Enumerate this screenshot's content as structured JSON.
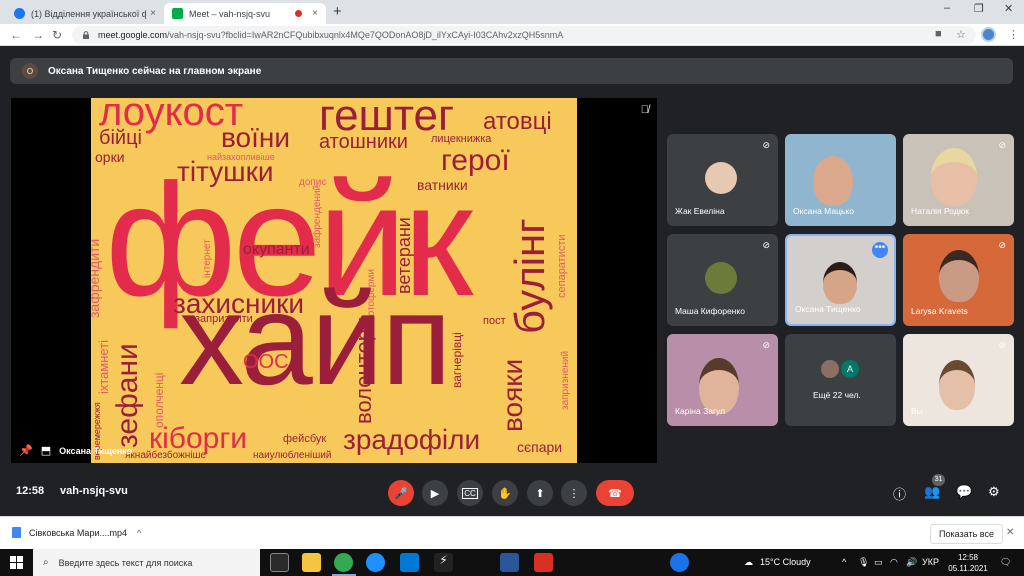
{
  "browser": {
    "tabs": [
      {
        "title": "(1) Відділення української філол",
        "close": "×"
      },
      {
        "title": "Meet – vah-nsjq-svu",
        "close": "×"
      }
    ],
    "new_tab": "+",
    "window_controls": [
      "–",
      "❐",
      "✕"
    ],
    "url_host": "meet.google.com",
    "url_path": "/vah-nsjq-svu?fbclid=IwAR2nCFQubibxuqnlx4MQe7QODonAO8jD_ilYxCAyi-I03CAhv2xzQH5snmA"
  },
  "banner": {
    "avatar_letter": "О",
    "text": "Оксана Тищенко сейчас на главном экране"
  },
  "stage": {
    "presenter_label": "Оксана Тищенко",
    "words": [
      "лоукост",
      "гештег",
      "атовці",
      "бійці",
      "воїни",
      "атошники",
      "лицекнижка",
      "орки",
      "найзахопливіше",
      "тітушки",
      "герої",
      "фейк",
      "допис",
      "ватники",
      "зафрендити",
      "інтернет",
      "зафрендений",
      "ветерани",
      "булінг",
      "сепаратисти",
      "окупанти",
      "іхтамнеті",
      "захисники",
      "ботоферми",
      "запризнити",
      "пост",
      "зефани",
      "ополченці",
      "хайп",
      "ООС",
      "вагнерівці",
      "волонтери",
      "вояки",
      "запризнений",
      "веремережжя",
      "кіборги",
      "фейсбук",
      "зрадофіли",
      "сєпари",
      "якнайбезбожніше",
      "наиулюбленіший"
    ]
  },
  "tiles": [
    {
      "name": "Жак Евеліна"
    },
    {
      "name": "Оксана Мацько"
    },
    {
      "name": "Наталія Родюк"
    },
    {
      "name": "Маша Кифоренко"
    },
    {
      "name": "Оксана Тищенко",
      "more": "•••"
    },
    {
      "name": "Larysa Kravets"
    },
    {
      "name": "Каріна Загул"
    },
    {
      "name": "Ещё 22 чел.",
      "avatar_letter": "А"
    },
    {
      "name": "Вы"
    }
  ],
  "bottom": {
    "time": "12:58",
    "meeting_code": "vah-nsjq-svu",
    "participants_count": "31"
  },
  "download": {
    "file_name": "Сівковська Мари....mp4",
    "show_all": "Показать все",
    "close": "✕"
  },
  "taskbar": {
    "search_placeholder": "Введите здесь текст для поиска",
    "weather": "15°C  Cloudy",
    "language": "УКР",
    "clock_time": "12:58",
    "clock_date": "05.11.2021"
  },
  "colors": {
    "meet_bg": "#202124",
    "tile_bg": "#3c4043",
    "danger": "#ea4335",
    "cloud_bg": "#f6c95a",
    "cloud_red": "#e32b4c",
    "cloud_dark": "#9b1f3a"
  }
}
